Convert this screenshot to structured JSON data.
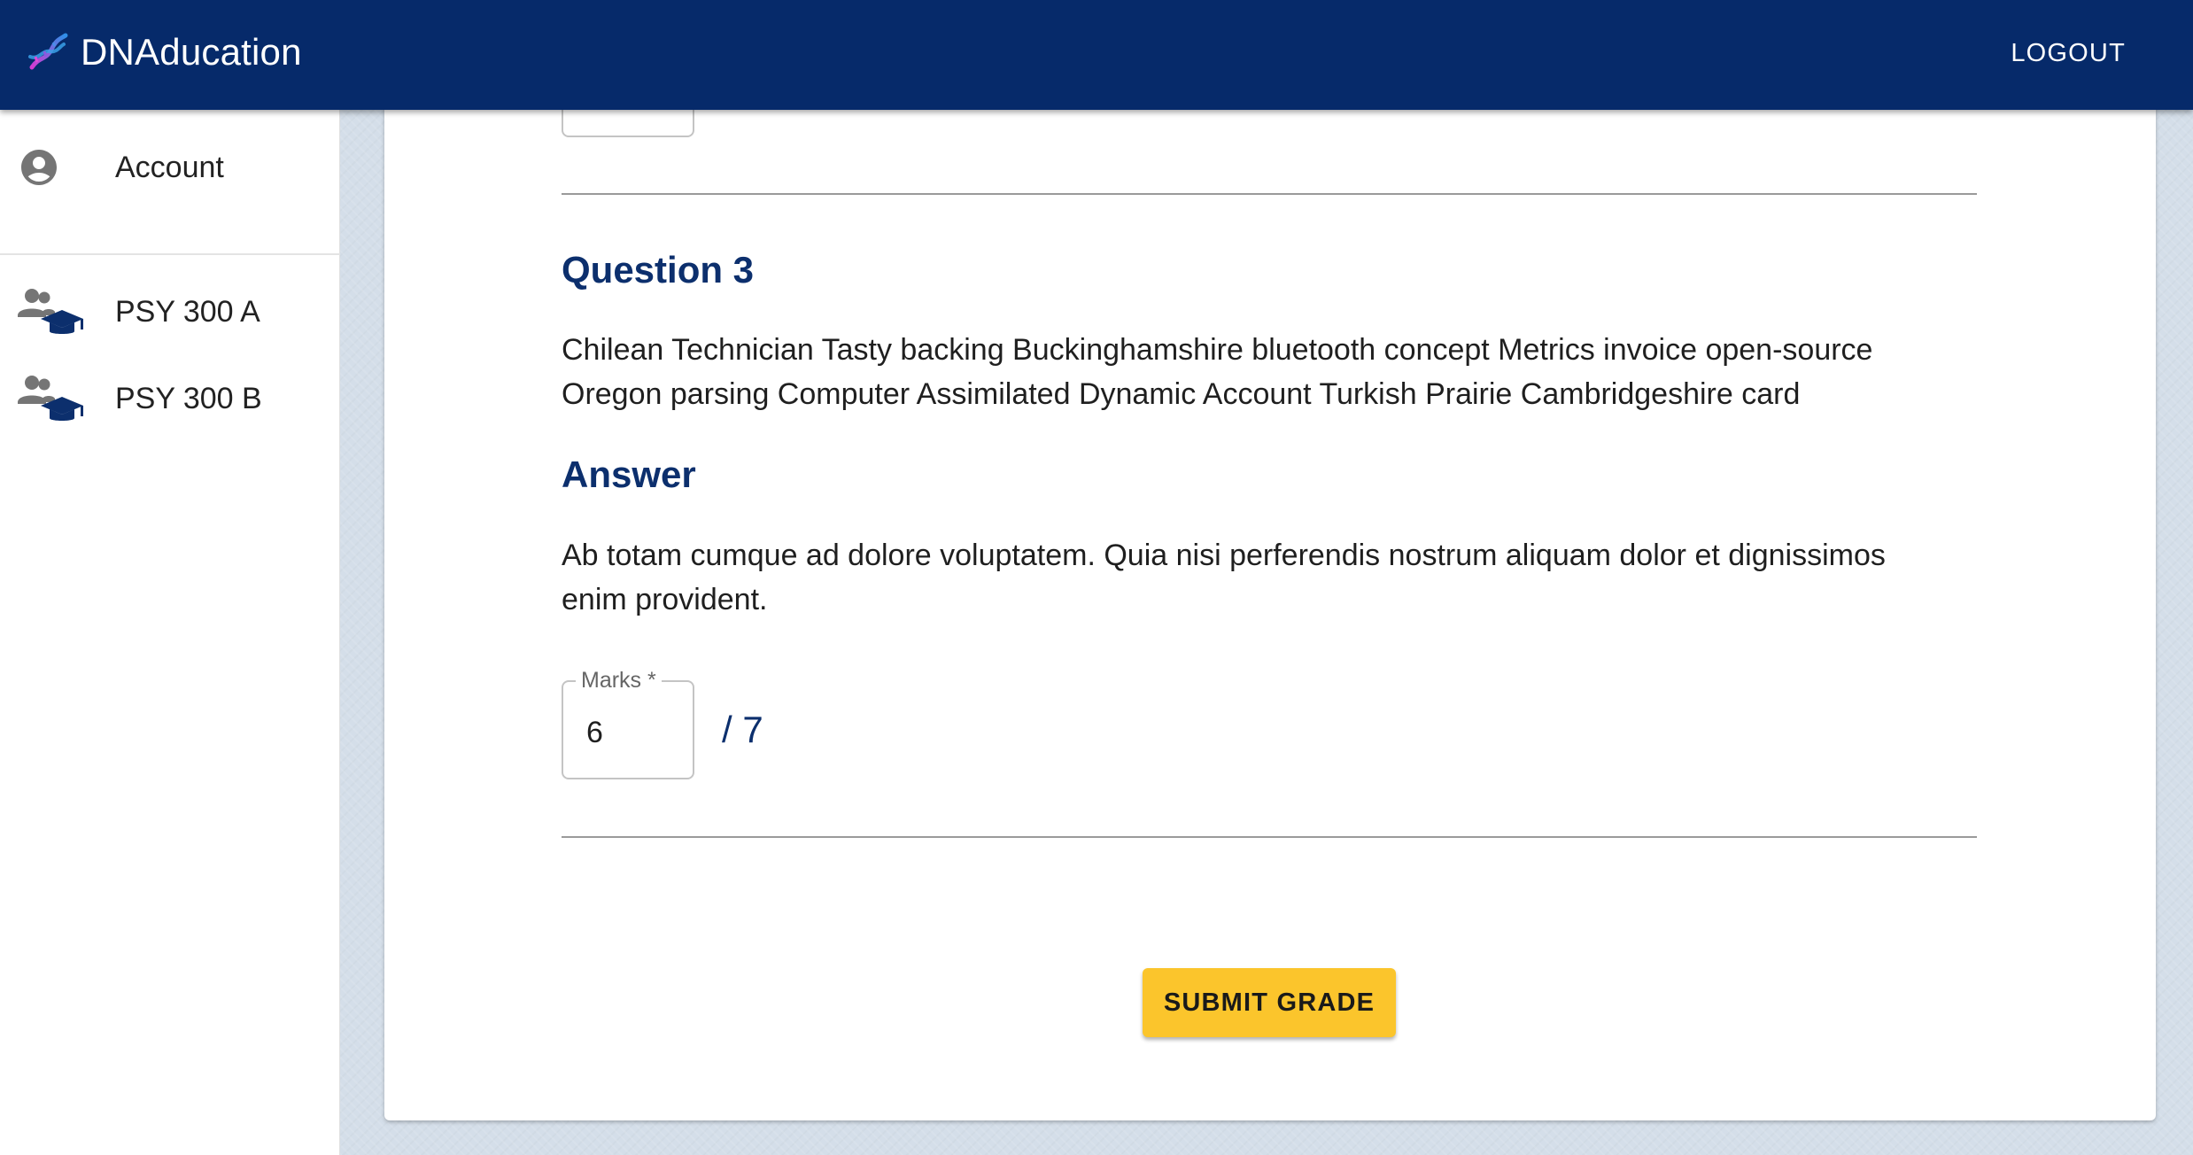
{
  "app": {
    "title": "DNAducation",
    "logout_label": "LOGOUT"
  },
  "sidebar": {
    "account_label": "Account",
    "courses": [
      {
        "label": "PSY 300 A"
      },
      {
        "label": "PSY 300 B"
      }
    ]
  },
  "question": {
    "heading": "Question 3",
    "text": "Chilean Technician Tasty backing Buckinghamshire bluetooth concept Metrics invoice open-source Oregon parsing Computer Assimilated Dynamic Account Turkish Prairie Cambridgeshire card",
    "answer_heading": "Answer",
    "answer_text": "Ab totam cumque ad dolore voluptatem. Quia nisi perferendis nostrum aliquam dolor et dignissimos enim provident."
  },
  "marks": {
    "label": "Marks *",
    "value": "6",
    "total": "/ 7"
  },
  "submit_label": "SUBMIT GRADE",
  "colors": {
    "appbar": "#062a6a",
    "heading": "#0c2f6d",
    "submit": "#fbc52c"
  },
  "icons": {
    "logo": "dna-icon",
    "account": "account-circle-icon",
    "course": "class-group-icon"
  }
}
